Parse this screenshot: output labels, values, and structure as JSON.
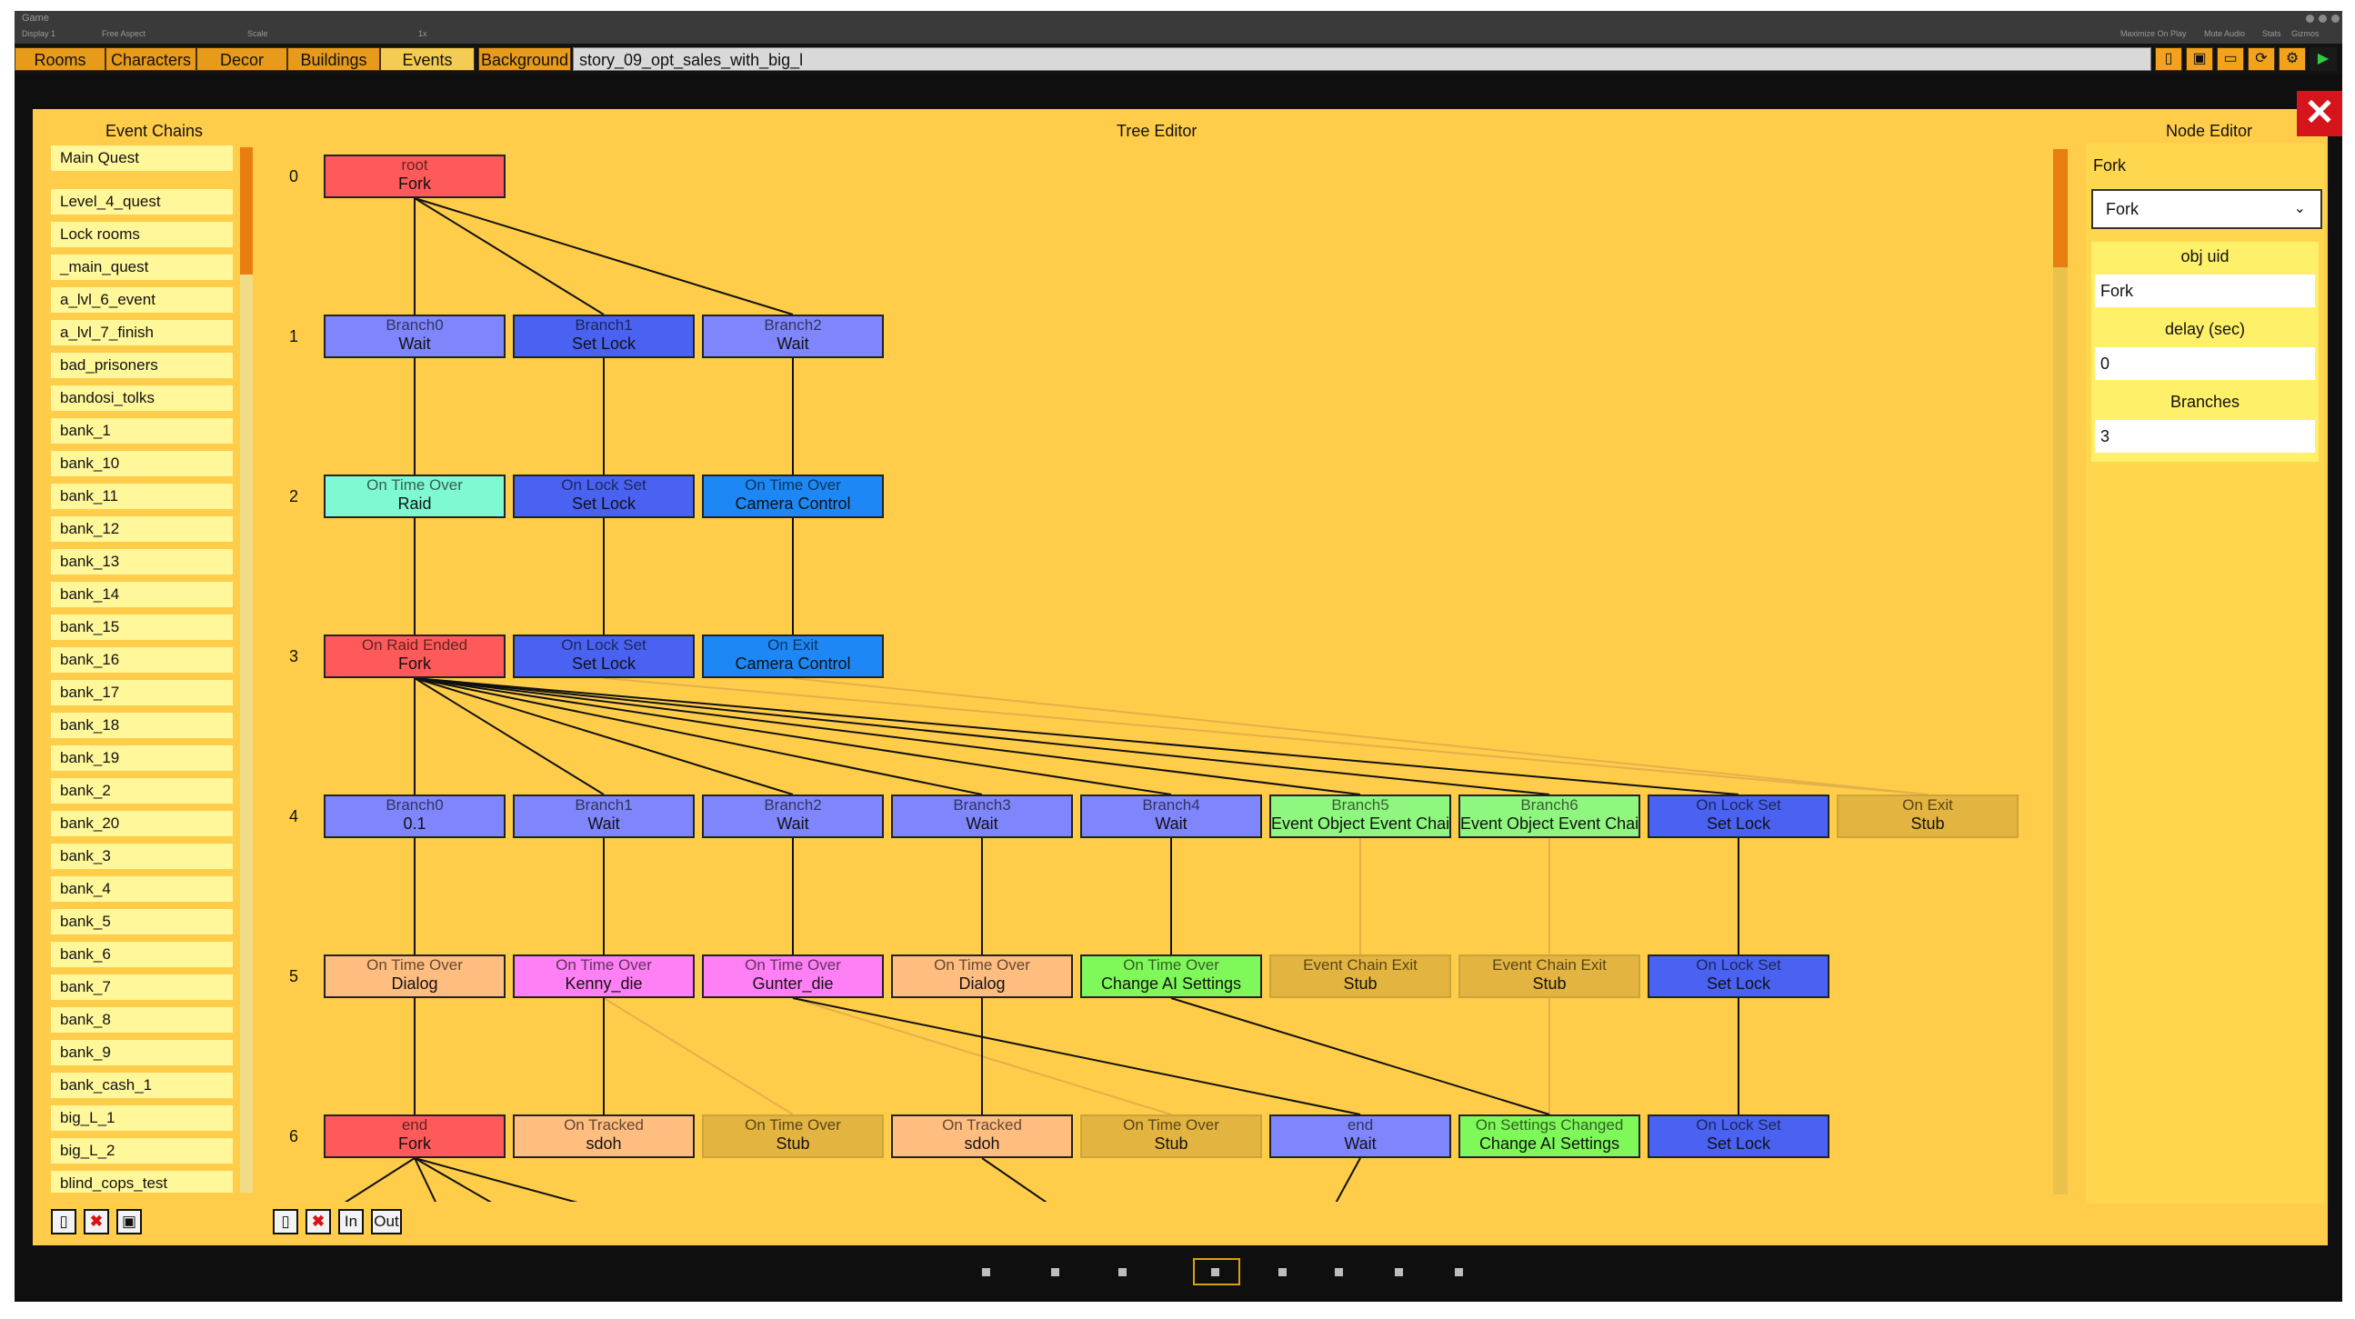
{
  "window": {
    "title": "Game",
    "display": "Display 1",
    "aspect": "Free Aspect",
    "scale_label": "Scale",
    "scale_value": "1x",
    "maximize_label": "Maximize On Play",
    "mute_label": "Mute Audio",
    "stats_label": "Stats",
    "gizmos_label": "Gizmos"
  },
  "tabs": [
    {
      "label": "Rooms"
    },
    {
      "label": "Characters"
    },
    {
      "label": "Decor"
    },
    {
      "label": "Buildings"
    },
    {
      "label": "Events"
    },
    {
      "label": "Background"
    }
  ],
  "active_tab": "Events",
  "story_name": "story_09_opt_sales_with_big_l",
  "toolbar_icons": [
    "new-file-icon",
    "save-icon",
    "folder-icon",
    "refresh-icon",
    "gear-icon",
    "play-icon"
  ],
  "panels": {
    "event_chains_title": "Event Chains",
    "tree_editor_title": "Tree Editor",
    "node_editor_title": "Node Editor"
  },
  "event_chains": [
    "Main Quest",
    "Level_4_quest",
    "Lock rooms",
    "_main_quest",
    "a_lvl_6_event",
    "a_lvl_7_finish",
    "bad_prisoners",
    "bandosi_tolks",
    "bank_1",
    "bank_10",
    "bank_11",
    "bank_12",
    "bank_13",
    "bank_14",
    "bank_15",
    "bank_16",
    "bank_17",
    "bank_18",
    "bank_19",
    "bank_2",
    "bank_20",
    "bank_3",
    "bank_4",
    "bank_5",
    "bank_6",
    "bank_7",
    "bank_8",
    "bank_9",
    "bank_cash_1",
    "big_L_1",
    "big_L_2",
    "blind_cops_test"
  ],
  "tree": {
    "row_labels": [
      "0",
      "1",
      "2",
      "3",
      "4",
      "5",
      "6"
    ],
    "nodes": [
      {
        "id": "n0",
        "row": 0,
        "col": 0,
        "event": "root",
        "action": "Fork",
        "color": "#ff5a5a"
      },
      {
        "id": "n1a",
        "row": 1,
        "col": 0,
        "event": "Branch0",
        "action": "Wait",
        "color": "#7f86fb"
      },
      {
        "id": "n1b",
        "row": 1,
        "col": 1,
        "event": "Branch1",
        "action": "Set Lock",
        "color": "#4a62f2"
      },
      {
        "id": "n1c",
        "row": 1,
        "col": 2,
        "event": "Branch2",
        "action": "Wait",
        "color": "#7f86fb"
      },
      {
        "id": "n2a",
        "row": 2,
        "col": 0,
        "event": "On Time Over",
        "action": "Raid",
        "color": "#7ff9d2"
      },
      {
        "id": "n2b",
        "row": 2,
        "col": 1,
        "event": "On Lock Set",
        "action": "Set Lock",
        "color": "#4a62f2"
      },
      {
        "id": "n2c",
        "row": 2,
        "col": 2,
        "event": "On Time Over",
        "action": "Camera Control",
        "color": "#1d88f5"
      },
      {
        "id": "n3a",
        "row": 3,
        "col": 0,
        "event": "On Raid Ended",
        "action": "Fork",
        "color": "#ff5a5a"
      },
      {
        "id": "n3b",
        "row": 3,
        "col": 1,
        "event": "On Lock Set",
        "action": "Set Lock",
        "color": "#4a62f2"
      },
      {
        "id": "n3c",
        "row": 3,
        "col": 2,
        "event": "On Exit",
        "action": "Camera Control",
        "color": "#1d88f5"
      },
      {
        "id": "n4a",
        "row": 4,
        "col": 0,
        "event": "Branch0",
        "action": "0.1",
        "color": "#7f86fb"
      },
      {
        "id": "n4b",
        "row": 4,
        "col": 1,
        "event": "Branch1",
        "action": "Wait",
        "color": "#7f86fb"
      },
      {
        "id": "n4c",
        "row": 4,
        "col": 2,
        "event": "Branch2",
        "action": "Wait",
        "color": "#7f86fb"
      },
      {
        "id": "n4d",
        "row": 4,
        "col": 3,
        "event": "Branch3",
        "action": "Wait",
        "color": "#7f86fb"
      },
      {
        "id": "n4e",
        "row": 4,
        "col": 4,
        "event": "Branch4",
        "action": "Wait",
        "color": "#7f86fb"
      },
      {
        "id": "n4f",
        "row": 4,
        "col": 5,
        "event": "Branch5",
        "action": "Event Object Event Chai",
        "color": "#8ff77f"
      },
      {
        "id": "n4g",
        "row": 4,
        "col": 6,
        "event": "Branch6",
        "action": "Event Object Event Chai",
        "color": "#8ff77f"
      },
      {
        "id": "n4h",
        "row": 4,
        "col": 7,
        "event": "On Lock Set",
        "action": "Set Lock",
        "color": "#4a62f2"
      },
      {
        "id": "n4i",
        "row": 4,
        "col": 8,
        "event": "On Exit",
        "action": "Stub",
        "color": "#e3b440",
        "ghost": true
      },
      {
        "id": "n5a",
        "row": 5,
        "col": 0,
        "event": "On Time Over",
        "action": "Dialog",
        "color": "#ffbd80"
      },
      {
        "id": "n5b",
        "row": 5,
        "col": 1,
        "event": "On Time Over",
        "action": "Kenny_die",
        "color": "#ff7ff5"
      },
      {
        "id": "n5c",
        "row": 5,
        "col": 2,
        "event": "On Time Over",
        "action": "Gunter_die",
        "color": "#ff7ff5"
      },
      {
        "id": "n5d",
        "row": 5,
        "col": 3,
        "event": "On Time Over",
        "action": "Dialog",
        "color": "#ffbd80"
      },
      {
        "id": "n5e",
        "row": 5,
        "col": 4,
        "event": "On Time Over",
        "action": "Change AI Settings",
        "color": "#7ff95a"
      },
      {
        "id": "n5f",
        "row": 5,
        "col": 5,
        "event": "Event Chain Exit",
        "action": "Stub",
        "color": "#e3b440",
        "ghost": true
      },
      {
        "id": "n5g",
        "row": 5,
        "col": 6,
        "event": "Event Chain Exit",
        "action": "Stub",
        "color": "#e3b440",
        "ghost": true
      },
      {
        "id": "n5h",
        "row": 5,
        "col": 7,
        "event": "On Lock Set",
        "action": "Set Lock",
        "color": "#4a62f2"
      },
      {
        "id": "n6a",
        "row": 6,
        "col": 0,
        "event": "end",
        "action": "Fork",
        "color": "#ff5a5a"
      },
      {
        "id": "n6b",
        "row": 6,
        "col": 1,
        "event": "On Tracked",
        "action": "sdoh",
        "color": "#ffbd80"
      },
      {
        "id": "n6c",
        "row": 6,
        "col": 2,
        "event": "On Time Over",
        "action": "Stub",
        "color": "#e3b440",
        "ghost": true
      },
      {
        "id": "n6d",
        "row": 6,
        "col": 3,
        "event": "On Tracked",
        "action": "sdoh",
        "color": "#ffbd80"
      },
      {
        "id": "n6e",
        "row": 6,
        "col": 4,
        "event": "On Time Over",
        "action": "Stub",
        "color": "#e3b440",
        "ghost": true
      },
      {
        "id": "n6f",
        "row": 6,
        "col": 5,
        "event": "end",
        "action": "Wait",
        "color": "#7f86fb"
      },
      {
        "id": "n6g",
        "row": 6,
        "col": 6,
        "event": "On Settings Changed",
        "action": "Change AI Settings",
        "color": "#7ff95a"
      },
      {
        "id": "n6h",
        "row": 6,
        "col": 7,
        "event": "On Lock Set",
        "action": "Set Lock",
        "color": "#4a62f2"
      }
    ],
    "edges": [
      [
        "n0",
        "n1a"
      ],
      [
        "n0",
        "n1b"
      ],
      [
        "n0",
        "n1c"
      ],
      [
        "n1a",
        "n2a"
      ],
      [
        "n1b",
        "n2b"
      ],
      [
        "n1c",
        "n2c"
      ],
      [
        "n2a",
        "n3a"
      ],
      [
        "n2b",
        "n3b"
      ],
      [
        "n2c",
        "n3c"
      ],
      [
        "n3a",
        "n4a"
      ],
      [
        "n3a",
        "n4b"
      ],
      [
        "n3a",
        "n4c"
      ],
      [
        "n3a",
        "n4d"
      ],
      [
        "n3a",
        "n4e"
      ],
      [
        "n3a",
        "n4f"
      ],
      [
        "n3a",
        "n4g"
      ],
      [
        "n3a",
        "n4h"
      ],
      [
        "n4a",
        "n5a"
      ],
      [
        "n4b",
        "n5b"
      ],
      [
        "n4c",
        "n5c"
      ],
      [
        "n4d",
        "n5d"
      ],
      [
        "n4e",
        "n5e"
      ],
      [
        "n4h",
        "n5h"
      ],
      [
        "n5a",
        "n6a"
      ],
      [
        "n5b",
        "n6b"
      ],
      [
        "n5c",
        "n6f"
      ],
      [
        "n5d",
        "n6d"
      ],
      [
        "n5e",
        "n6g"
      ],
      [
        "n5h",
        "n6h"
      ],
      [
        "n6a",
        "offscreen1"
      ],
      [
        "n6a",
        "offscreen2"
      ],
      [
        "n6a",
        "offscreen3"
      ],
      [
        "n6a",
        "offscreen4"
      ],
      [
        "n6d",
        "offscreen5"
      ],
      [
        "n6f",
        "offscreen6"
      ]
    ],
    "faint_edges": [
      [
        "n3b",
        "n4i"
      ],
      [
        "n3c",
        "n4i"
      ],
      [
        "n4f",
        "n5f"
      ],
      [
        "n4g",
        "n5g"
      ],
      [
        "n5b",
        "n6c"
      ],
      [
        "n5c",
        "n6e"
      ],
      [
        "n5g",
        "n6g"
      ]
    ]
  },
  "node_editor": {
    "node_name": "Fork",
    "type_selected": "Fork",
    "obj_uid_label": "obj uid",
    "obj_uid_value": "Fork",
    "delay_label": "delay (sec)",
    "delay_value": "0",
    "branches_label": "Branches",
    "branches_value": "3"
  },
  "chain_buttons": [
    "new-icon",
    "delete-icon",
    "save-icon"
  ],
  "tree_buttons": {
    "in_label": "In",
    "out_label": "Out"
  },
  "close_icon": "close-icon",
  "colors": {
    "panel_bg": "#ffcd4a",
    "list_item_bg": "#fff79a",
    "tab_bg": "#e89a1a",
    "scroll_thumb": "#e87d10",
    "close_red": "#d6141b"
  }
}
